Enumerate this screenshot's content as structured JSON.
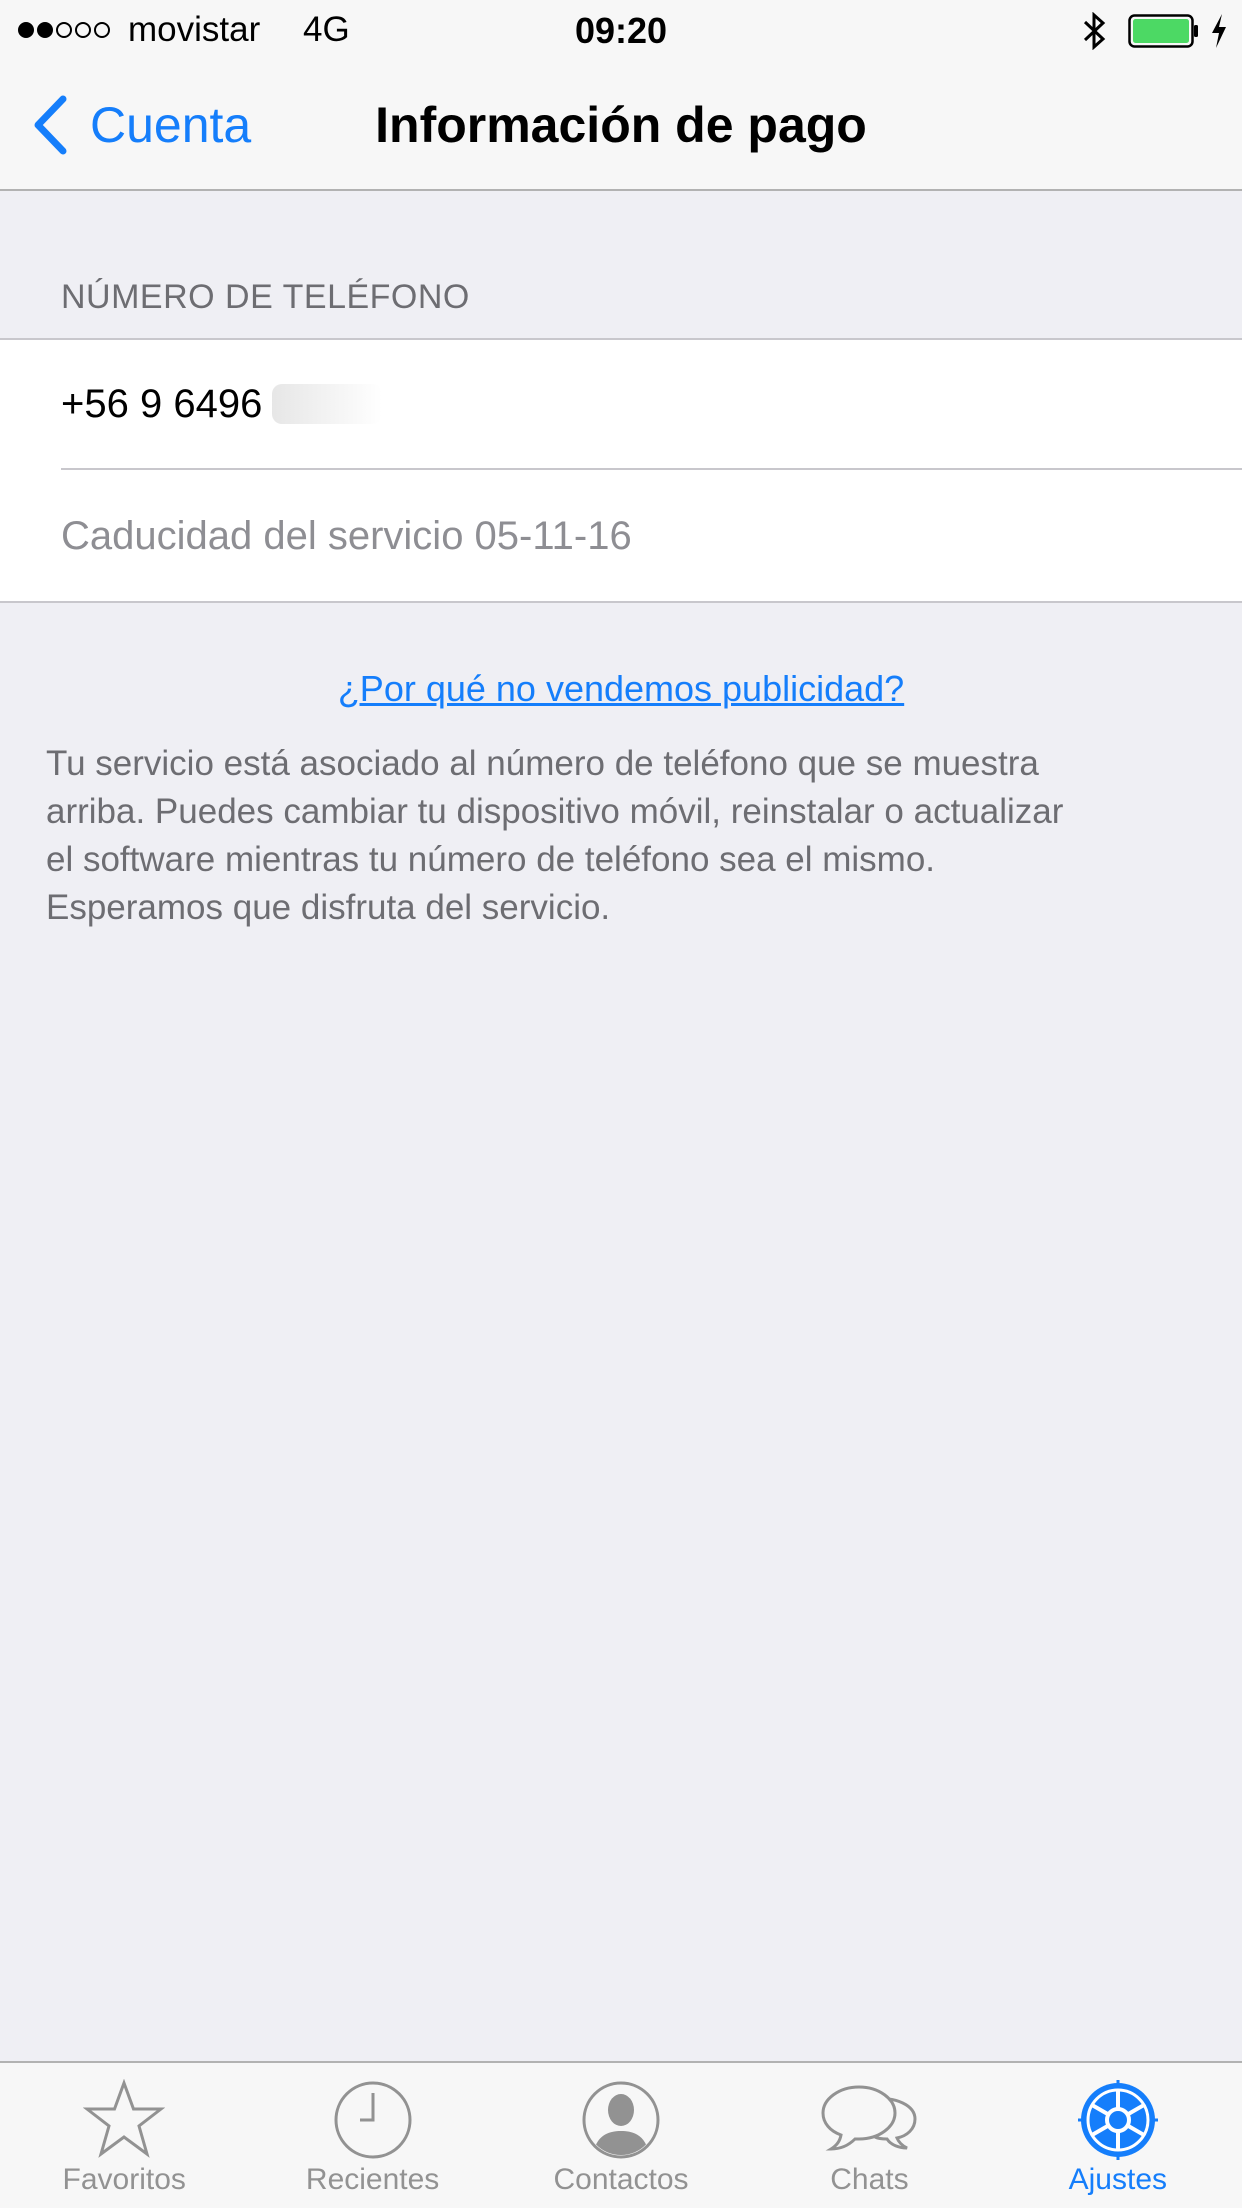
{
  "status_bar": {
    "carrier": "movistar",
    "network": "4G",
    "time": "09:20",
    "signal_bars_filled": 2,
    "signal_bars_total": 5,
    "bluetooth_icon": "bluetooth-icon",
    "battery_icon": "battery-charging-icon",
    "battery_color": "#4cd964"
  },
  "nav": {
    "back_label": "Cuenta",
    "title": "Información de pago"
  },
  "section": {
    "header": "NÚMERO DE TELÉFONO",
    "phone": "+56 9 6496",
    "expiry": "Caducidad del servicio 05-11-16"
  },
  "link_text": "¿Por qué no vendemos publicidad?",
  "description": "Tu servicio está asociado al número de teléfono que se muestra\narriba.  Puedes cambiar tu dispositivo móvil, reinstalar o actualizar\nel software mientras tu número de teléfono sea el mismo.\nEsperamos que disfruta del servicio.",
  "tabs": [
    {
      "label": "Favoritos",
      "icon": "star-icon",
      "active": false
    },
    {
      "label": "Recientes",
      "icon": "clock-icon",
      "active": false
    },
    {
      "label": "Contactos",
      "icon": "contact-icon",
      "active": false
    },
    {
      "label": "Chats",
      "icon": "chat-bubbles-icon",
      "active": false
    },
    {
      "label": "Ajustes",
      "icon": "gear-icon",
      "active": true
    }
  ],
  "colors": {
    "accent": "#157efb",
    "background": "#efeff4",
    "inactive_tab": "#929292"
  }
}
